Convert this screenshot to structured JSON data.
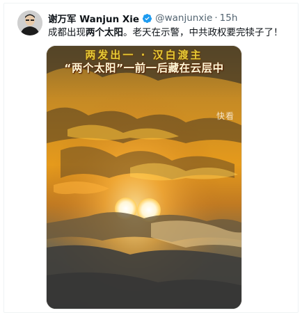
{
  "tweet": {
    "display_name": "谢万军 Wanjun Xie",
    "handle": "@wanjunxie",
    "separator": "·",
    "time": "15h",
    "text_part1": "成都出现",
    "text_bold": "两个太阳",
    "text_part2": "。老天在示警，中共政权要完犊子了！"
  },
  "media": {
    "caption_top": "两发出一 · 汉白渡主",
    "caption_main": "“两个太阳”一前一后藏在云层中",
    "watermark": "快看"
  },
  "colors": {
    "verified": "#1d9bf0",
    "sky_gold": "#f2a51c",
    "cloud_dark": "#3b3a34"
  },
  "icons": {
    "verified": "verified-badge-icon"
  }
}
